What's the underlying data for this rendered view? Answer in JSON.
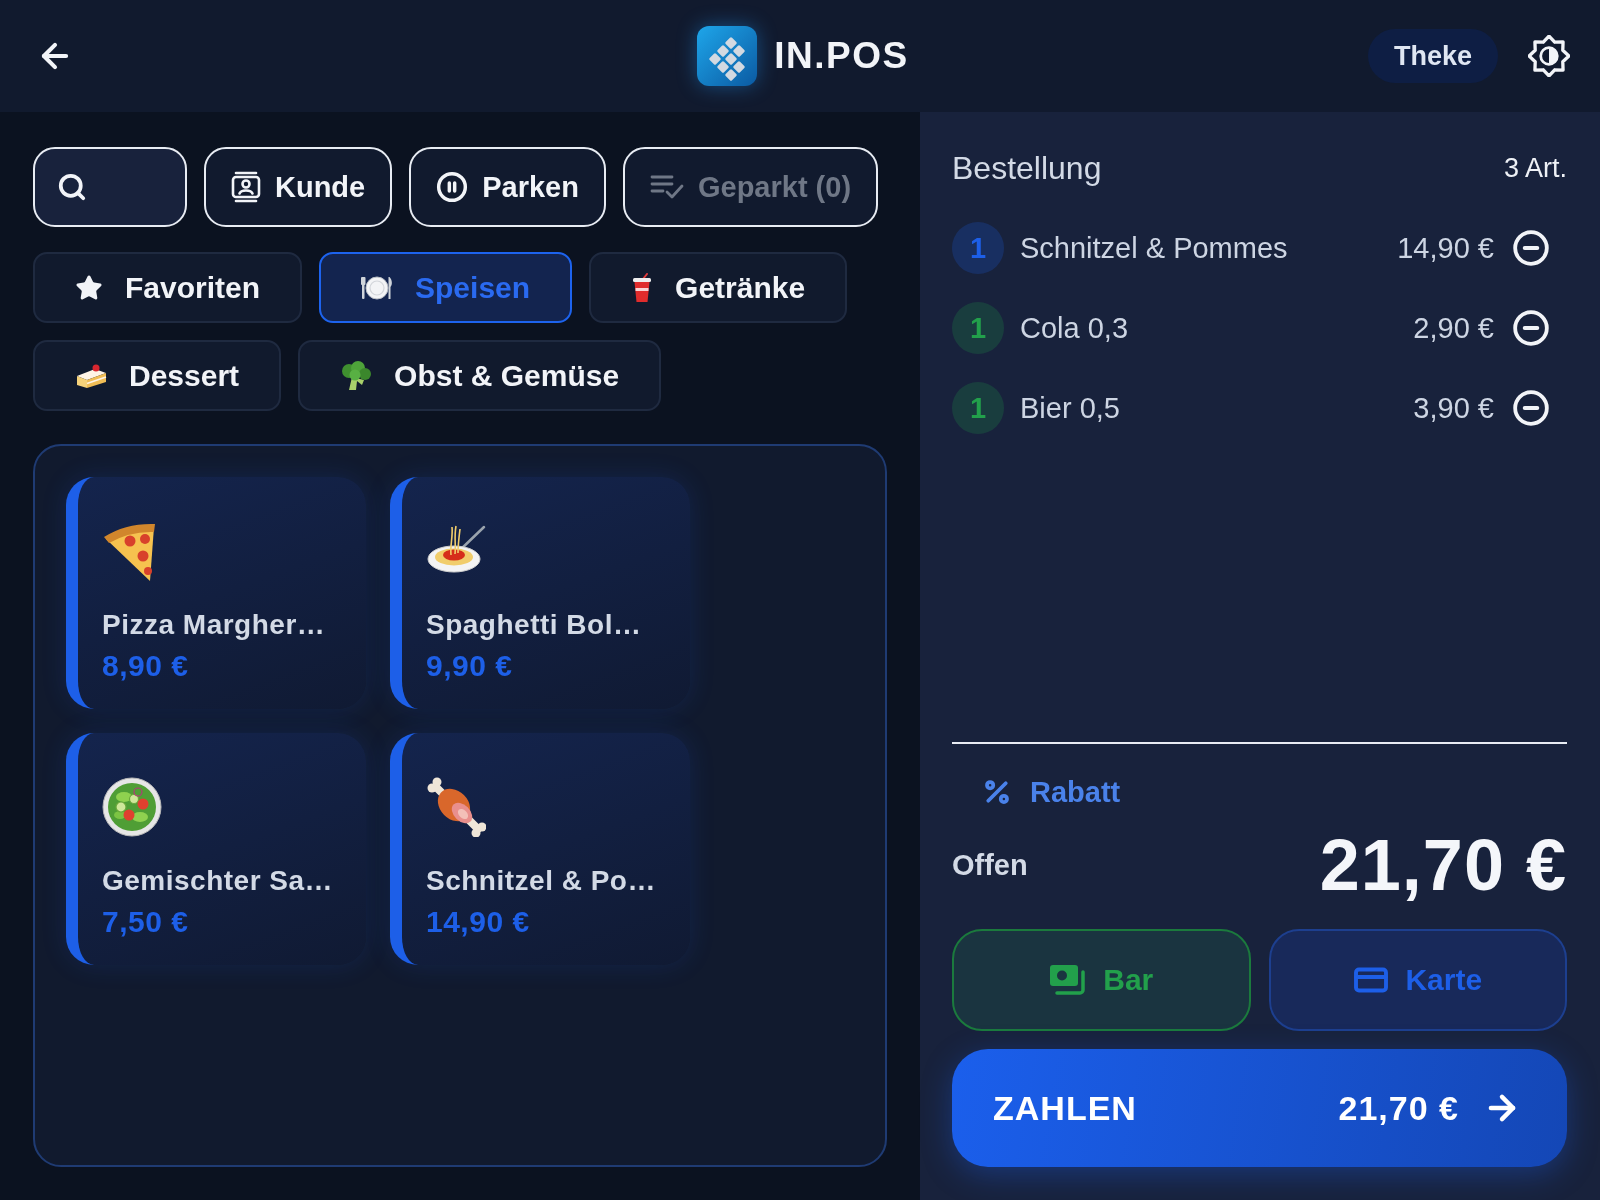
{
  "header": {
    "title": "IN.POS",
    "location": "Theke"
  },
  "toolbar": {
    "buttons": [
      {
        "label": "Kunde",
        "kind": "customer",
        "disabled": false
      },
      {
        "label": "Parken",
        "kind": "park",
        "disabled": false
      },
      {
        "label": "Geparkt (0)",
        "kind": "parked",
        "disabled": true
      }
    ]
  },
  "categories": [
    {
      "label": "Favoriten",
      "kind": "star",
      "selected": false
    },
    {
      "label": "Speisen",
      "kind": "plate",
      "selected": true
    },
    {
      "label": "Getränke",
      "kind": "cup",
      "selected": false
    },
    {
      "label": "Dessert",
      "kind": "cake",
      "selected": false
    },
    {
      "label": "Obst & Gemüse",
      "kind": "broccoli",
      "selected": false
    }
  ],
  "products": [
    {
      "name": "Pizza Margher…",
      "price": "8,90 €",
      "kind": "pizza"
    },
    {
      "name": "Spaghetti Bol…",
      "price": "9,90 €",
      "kind": "pasta"
    },
    {
      "name": "Gemischter Sa…",
      "price": "7,50 €",
      "kind": "salad"
    },
    {
      "name": "Schnitzel & Po…",
      "price": "14,90 €",
      "kind": "meat"
    }
  ],
  "order": {
    "title": "Bestellung",
    "count": "3 Art.",
    "items": [
      {
        "qty": "1",
        "name": "Schnitzel & Pommes",
        "price": "14,90 €",
        "color": "#1d5fe8"
      },
      {
        "qty": "1",
        "name": "Cola 0,3",
        "price": "2,90 €",
        "color": "#22a04b"
      },
      {
        "qty": "1",
        "name": "Bier 0,5",
        "price": "3,90 €",
        "color": "#22a04b"
      }
    ],
    "discount": "Rabatt",
    "open_label": "Offen",
    "total": "21,70 €",
    "payment_methods": [
      {
        "label": "Bar",
        "kind": "cash"
      },
      {
        "label": "Karte",
        "kind": "card"
      }
    ],
    "pay_button": {
      "label": "ZAHLEN",
      "amount": "21,70 €"
    }
  }
}
